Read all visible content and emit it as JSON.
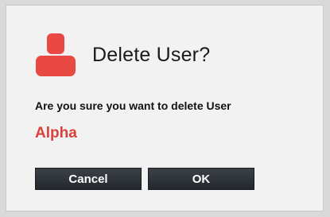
{
  "dialog": {
    "title": "Delete User?",
    "icon": "user-icon",
    "accent_color": "#d9423c",
    "prompt": "Are you sure you want to delete User",
    "username": "Alpha",
    "buttons": {
      "cancel_label": "Cancel",
      "ok_label": "OK"
    }
  }
}
